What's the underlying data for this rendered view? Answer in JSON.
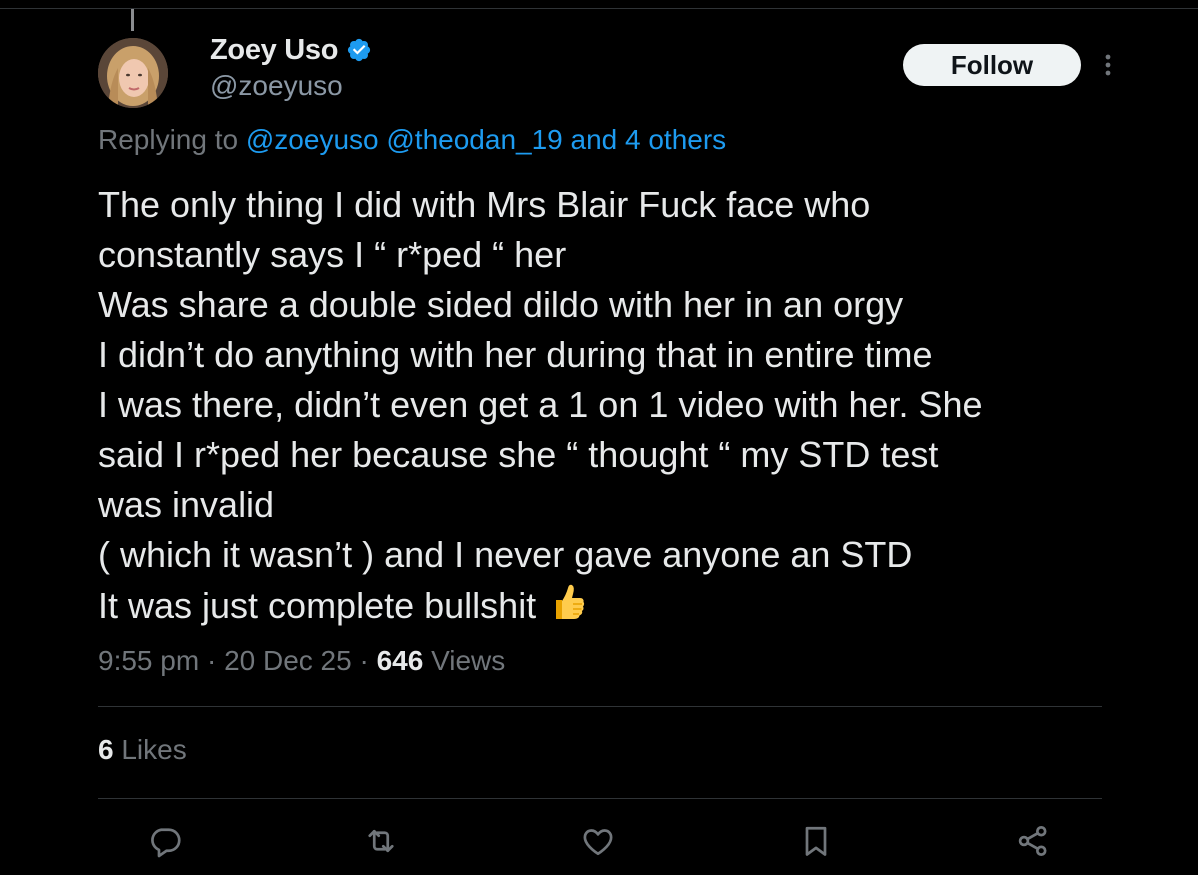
{
  "author": {
    "display_name": "Zoey Uso",
    "handle": "@zoeyuso",
    "verified_icon": "verified-badge-icon",
    "avatar_icon": "avatar-photo"
  },
  "follow_button": {
    "label": "Follow"
  },
  "more_menu": {
    "icon": "more-vertical-icon"
  },
  "reply_context": {
    "prefix": "Replying to ",
    "mention_1": "@zoeyuso",
    "mention_2": "@theodan_19",
    "others": "and 4 others"
  },
  "tweet": {
    "lines": [
      "The only thing I did with Mrs Blair Fuck face who",
      "constantly says I “ r*ped “ her",
      "Was share a double sided dildo with her in an orgy",
      "I didn’t do anything with her during that in entire time",
      "I was there, didn’t even get a 1 on 1 video with her. She",
      "said I r*ped her because she “ thought “ my STD test",
      "was invalid",
      "( which it wasn’t ) and I never gave anyone an STD",
      "It was just complete bullshit"
    ],
    "emoji": "thumbs-up-icon"
  },
  "meta": {
    "time": "9:55 pm",
    "sep": " · ",
    "date": "20 Dec 25",
    "views_count": "646",
    "views_label": " Views"
  },
  "likes": {
    "count": "6",
    "label": " Likes"
  },
  "actions": {
    "icons": [
      "reply-icon",
      "repost-icon",
      "like-icon",
      "bookmark-icon",
      "share-icon"
    ]
  },
  "colors": {
    "background": "#000000",
    "text_primary": "#e7e9ea",
    "text_secondary": "#71767b",
    "accent": "#1d9bf0",
    "divider": "#2f3336",
    "follow_bg": "#eff3f4"
  }
}
